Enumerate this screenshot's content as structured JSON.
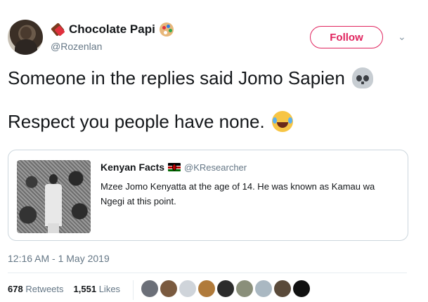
{
  "author": {
    "display_name": "Chocolate Papi",
    "handle": "@Rozenlan",
    "name_icons": [
      "chocolate-bar-icon",
      "artist-palette-icon"
    ]
  },
  "follow_button": {
    "label": "Follow"
  },
  "menu": {
    "chevron": "⌄"
  },
  "tweet": {
    "line1": "Someone in the replies said Jomo Sapien",
    "line1_emoji": "skull-emoji",
    "line2": "Respect you people have none.",
    "line2_emoji": "tears-of-joy-emoji"
  },
  "quoted_tweet": {
    "name": "Kenyan Facts",
    "flag": "kenya-flag-icon",
    "handle": "@KResearcher",
    "text": "Mzee Jomo Kenyatta at the age of 14. He was known as Kamau wa Ngegi at this point."
  },
  "meta": {
    "timestamp": "12:16 AM - 1 May 2019",
    "retweets_count": "678",
    "retweets_label": "Retweets",
    "likes_count": "1,551",
    "likes_label": "Likes"
  },
  "likers": [
    {
      "color": "#6b6f78"
    },
    {
      "color": "#7a5a3f"
    },
    {
      "color": "#cfd4da"
    },
    {
      "color": "#b07a3a"
    },
    {
      "color": "#2b2b2b"
    },
    {
      "color": "#8a8f7a"
    },
    {
      "color": "#aab8c2"
    },
    {
      "color": "#5a4a3a"
    },
    {
      "color": "#111111"
    }
  ]
}
